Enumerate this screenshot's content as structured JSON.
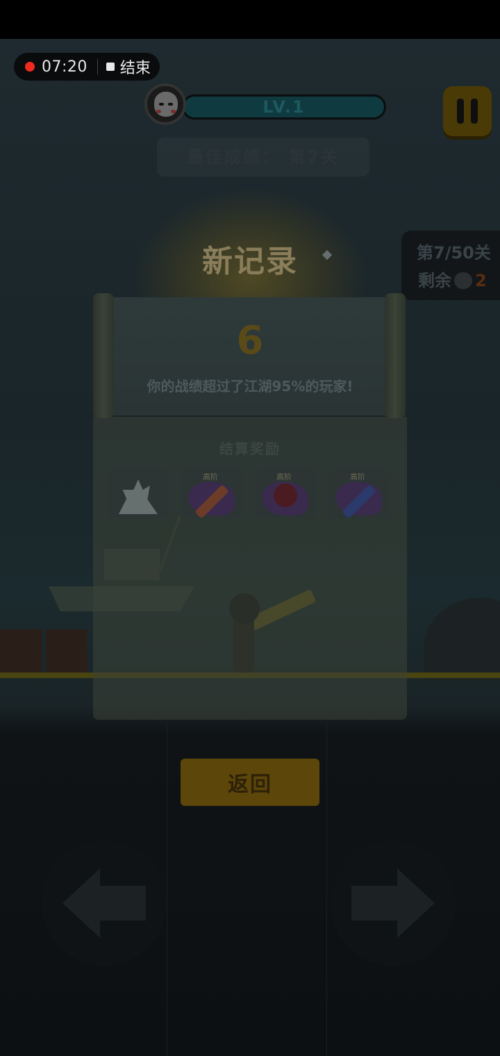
{
  "recording": {
    "time": "07:20",
    "stop_label": "结束"
  },
  "player": {
    "level": "LV.1"
  },
  "best": {
    "text": "最佳成绩： 第7关"
  },
  "stage": {
    "progress": "第7/50关",
    "remaining_label": "剩余",
    "remaining_count": "2"
  },
  "result": {
    "title": "新记录",
    "score": "6",
    "beat_text": "你的战绩超过了江湖95%的玩家!",
    "rewards_title": "结算奖励",
    "rewards": [
      {
        "icon": "crystal-icon",
        "tag": ""
      },
      {
        "icon": "sword-icon",
        "tag": "高阶"
      },
      {
        "icon": "flower-icon",
        "tag": "高阶"
      },
      {
        "icon": "blade-icon",
        "tag": "高阶"
      }
    ]
  },
  "buttons": {
    "back": "返回"
  },
  "colors": {
    "accent": "#5d4609",
    "record_dot": "#f2291e",
    "level_bar": "#0f3a40"
  }
}
